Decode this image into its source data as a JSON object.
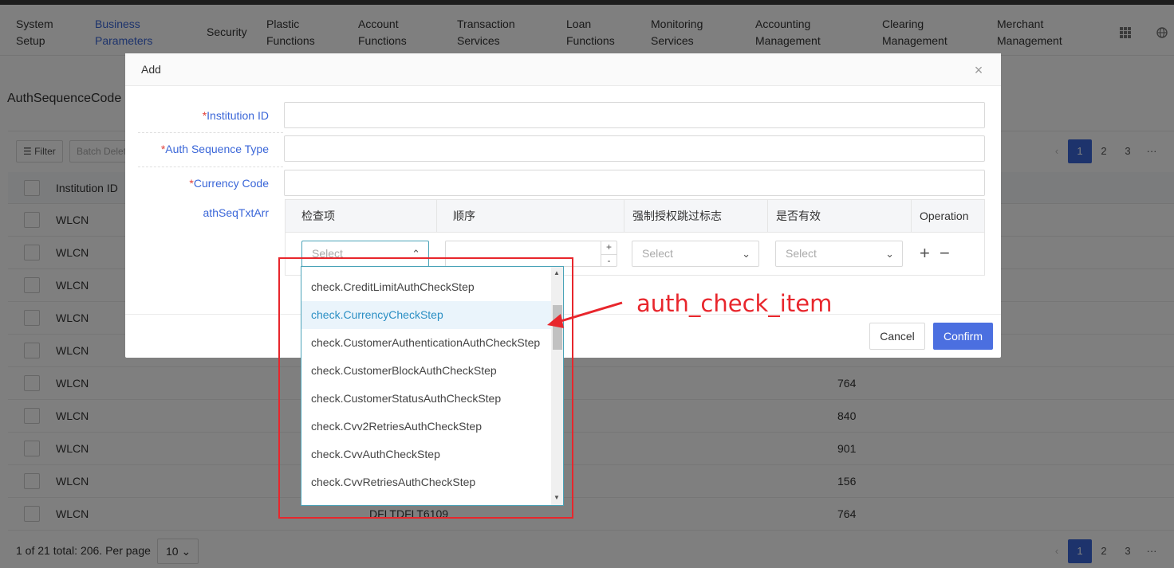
{
  "nav": {
    "items": [
      {
        "l1": "System",
        "l2": "Setup"
      },
      {
        "l1": "Business",
        "l2": "Parameters"
      },
      {
        "l1": "Security",
        "l2": ""
      },
      {
        "l1": "Plastic",
        "l2": "Functions"
      },
      {
        "l1": "Account",
        "l2": "Functions"
      },
      {
        "l1": "Transaction",
        "l2": "Services"
      },
      {
        "l1": "Loan",
        "l2": "Functions"
      },
      {
        "l1": "Monitoring",
        "l2": "Services"
      },
      {
        "l1": "Accounting",
        "l2": "Management"
      },
      {
        "l1": "Clearing",
        "l2": "Management"
      },
      {
        "l1": "Merchant",
        "l2": "Management"
      }
    ],
    "active_index": 1
  },
  "page": {
    "title": "AuthSequenceCode",
    "filter_label": "Filter",
    "batch_delete_label": "Batch Delete",
    "col_institution": "Institution ID",
    "rows": [
      {
        "inst": "WLCN",
        "code": "",
        "num": ""
      },
      {
        "inst": "WLCN",
        "code": "",
        "num": ""
      },
      {
        "inst": "WLCN",
        "code": "",
        "num": ""
      },
      {
        "inst": "WLCN",
        "code": "",
        "num": ""
      },
      {
        "inst": "WLCN",
        "code": "",
        "num": ""
      },
      {
        "inst": "WLCN",
        "code": "",
        "num": "764"
      },
      {
        "inst": "WLCN",
        "code": "",
        "num": "840"
      },
      {
        "inst": "WLCN",
        "code": "",
        "num": "901"
      },
      {
        "inst": "WLCN",
        "code": "",
        "num": "156"
      },
      {
        "inst": "WLCN",
        "code": "DFLTDFLT6109",
        "num": "764"
      }
    ],
    "pagination": {
      "pages": [
        "1",
        "2",
        "3",
        "···"
      ],
      "active": "1"
    },
    "footer_summary": "1 of 21 total: 206. Per page",
    "page_size": "10"
  },
  "modal": {
    "title": "Add",
    "fields": {
      "institution_id": {
        "label": "Institution ID",
        "value": ""
      },
      "auth_sequence_type": {
        "label": "Auth Sequence Type",
        "value": ""
      },
      "currency_code": {
        "label": "Currency Code",
        "value": ""
      }
    },
    "subtable_label": "athSeqTxtArr",
    "subtable": {
      "headers": [
        "检查项",
        "顺序",
        "强制授权跳过标志",
        "是否有效",
        "Operation"
      ],
      "row": {
        "check_item": "Select",
        "order": "",
        "force_skip": "Select",
        "valid": "Select"
      }
    },
    "cancel_label": "Cancel",
    "confirm_label": "Confirm"
  },
  "dropdown": {
    "options": [
      "check.CreditLimitAuthCheckStep",
      "check.CurrencyCheckStep",
      "check.CustomerAuthenticationAuthCheckStep",
      "check.CustomerBlockAuthCheckStep",
      "check.CustomerStatusAuthCheckStep",
      "check.Cvv2RetriesAuthCheckStep",
      "check.CvvAuthCheckStep",
      "check.CvvRetriesAuthCheckStep"
    ],
    "hover_index": 1
  },
  "annotation": {
    "text": "auth_check_item",
    "color": "#e8262c"
  },
  "colors": {
    "accent": "#3a66d8",
    "confirm": "#4b6fe0",
    "required": "#e0403a",
    "focus": "#4aa3b8"
  }
}
